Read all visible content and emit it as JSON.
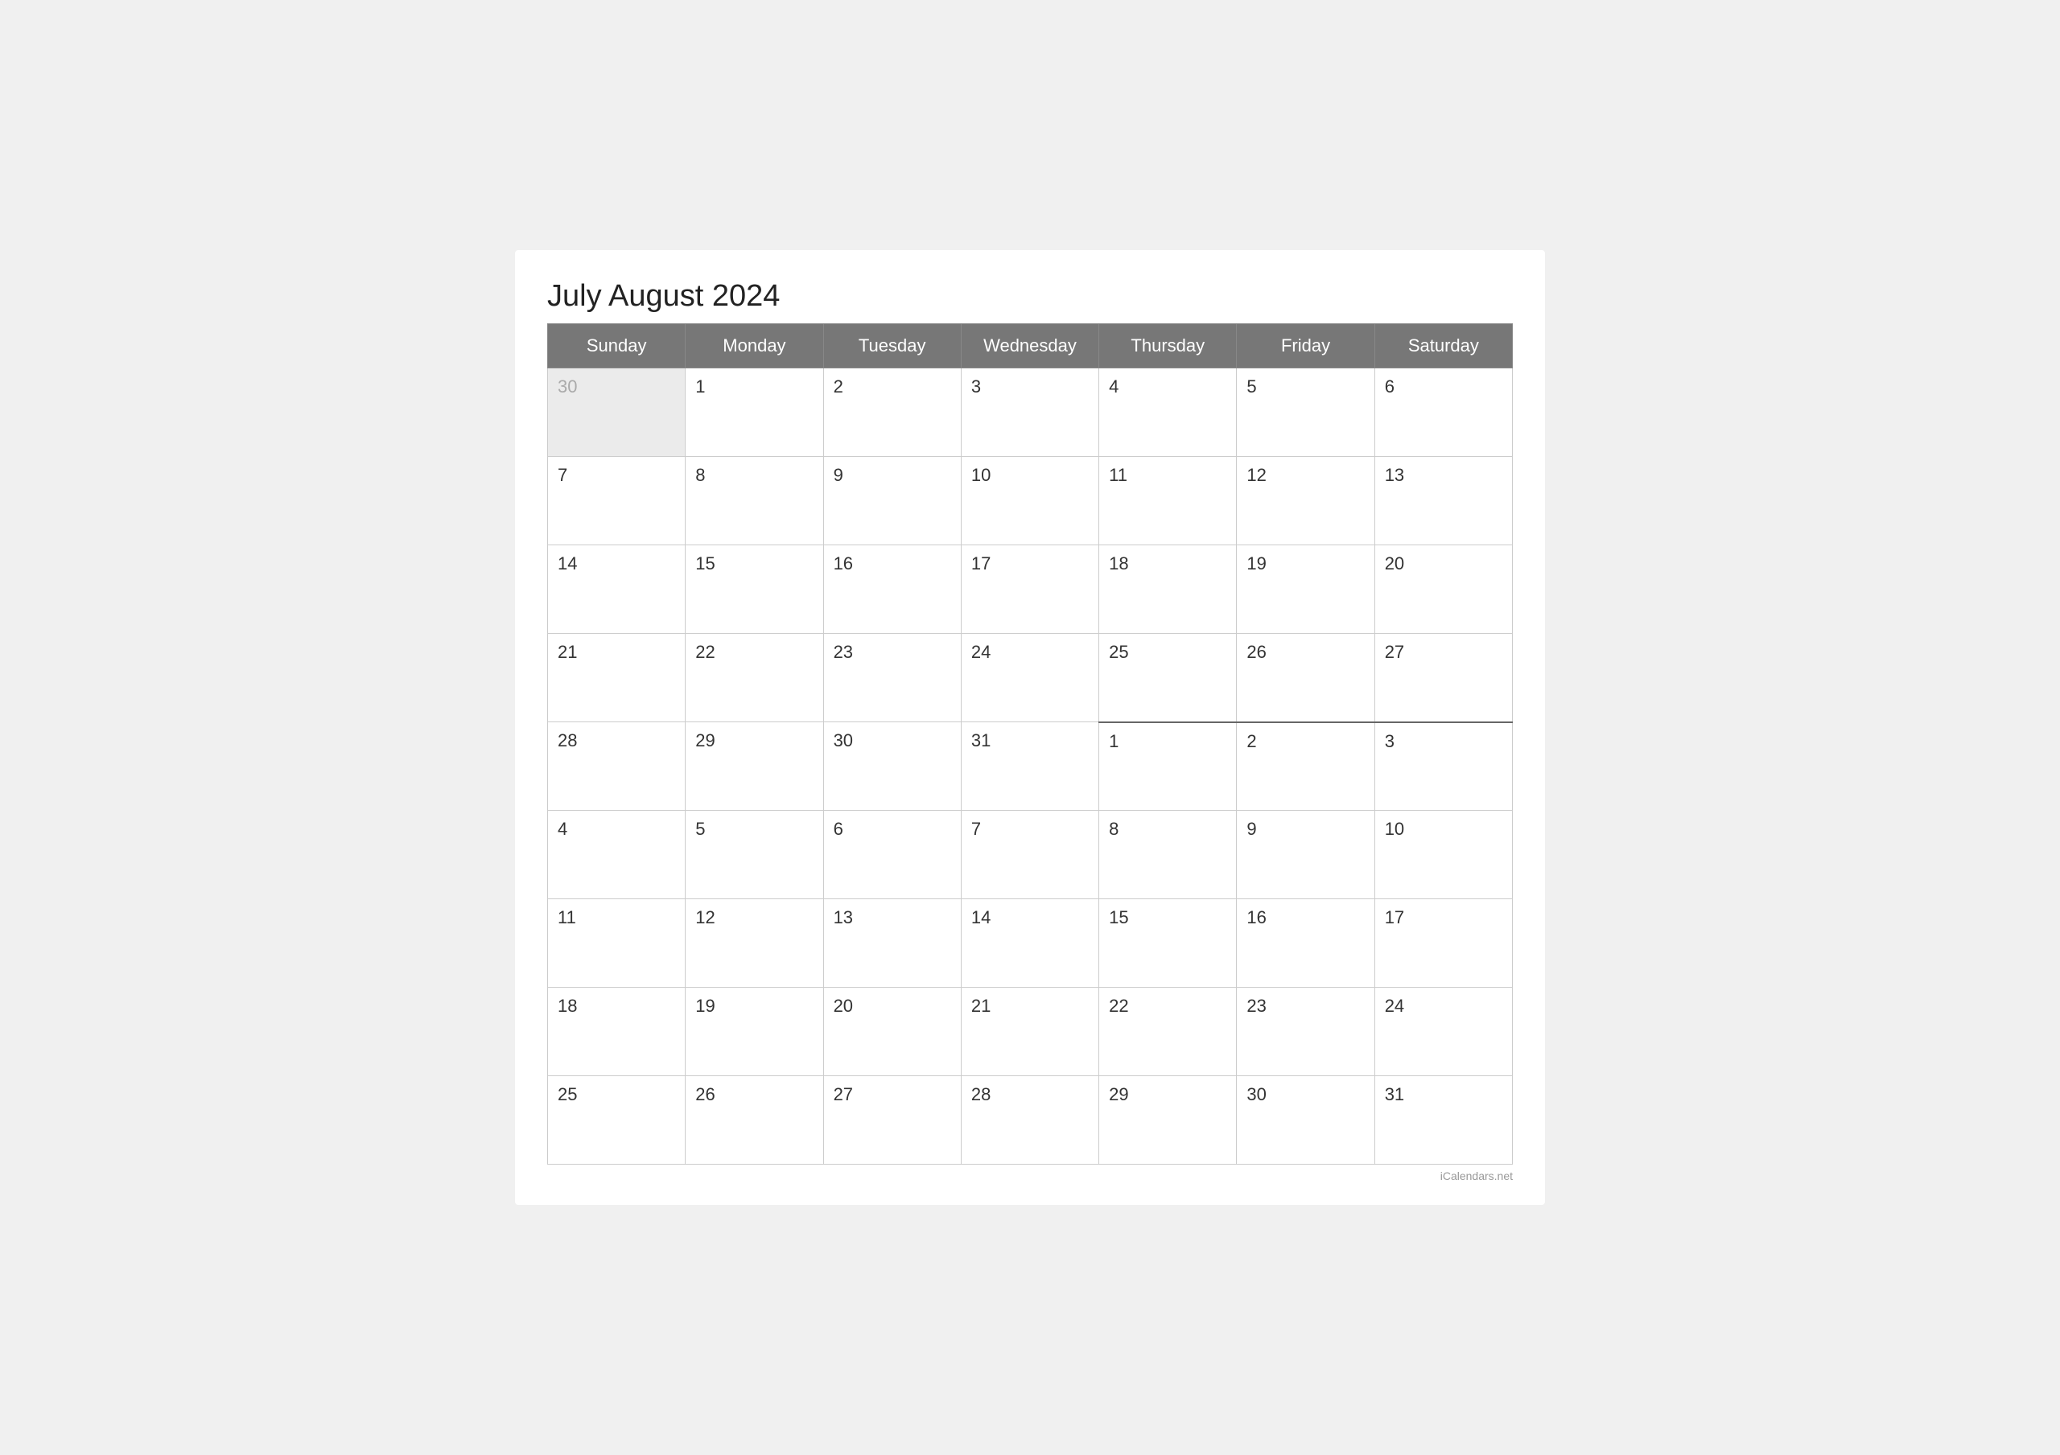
{
  "calendar": {
    "title": "July August 2024",
    "watermark": "iCalendars.net",
    "headers": [
      "Sunday",
      "Monday",
      "Tuesday",
      "Wednesday",
      "Thursday",
      "Friday",
      "Saturday"
    ],
    "weeks": [
      {
        "days": [
          {
            "num": "30",
            "type": "prev-month"
          },
          {
            "num": "1",
            "type": "july"
          },
          {
            "num": "2",
            "type": "july"
          },
          {
            "num": "3",
            "type": "july"
          },
          {
            "num": "4",
            "type": "july"
          },
          {
            "num": "5",
            "type": "july"
          },
          {
            "num": "6",
            "type": "july"
          }
        ]
      },
      {
        "days": [
          {
            "num": "7",
            "type": "july"
          },
          {
            "num": "8",
            "type": "july"
          },
          {
            "num": "9",
            "type": "july"
          },
          {
            "num": "10",
            "type": "july"
          },
          {
            "num": "11",
            "type": "july"
          },
          {
            "num": "12",
            "type": "july"
          },
          {
            "num": "13",
            "type": "july"
          }
        ]
      },
      {
        "days": [
          {
            "num": "14",
            "type": "july"
          },
          {
            "num": "15",
            "type": "july"
          },
          {
            "num": "16",
            "type": "july"
          },
          {
            "num": "17",
            "type": "july"
          },
          {
            "num": "18",
            "type": "july"
          },
          {
            "num": "19",
            "type": "july"
          },
          {
            "num": "20",
            "type": "july"
          }
        ]
      },
      {
        "days": [
          {
            "num": "21",
            "type": "july"
          },
          {
            "num": "22",
            "type": "july"
          },
          {
            "num": "23",
            "type": "july"
          },
          {
            "num": "24",
            "type": "july"
          },
          {
            "num": "25",
            "type": "july"
          },
          {
            "num": "26",
            "type": "july"
          },
          {
            "num": "27",
            "type": "july"
          }
        ]
      },
      {
        "days": [
          {
            "num": "28",
            "type": "july"
          },
          {
            "num": "29",
            "type": "july"
          },
          {
            "num": "30",
            "type": "july"
          },
          {
            "num": "31",
            "type": "july"
          },
          {
            "num": "1",
            "type": "august",
            "divider": true
          },
          {
            "num": "2",
            "type": "august",
            "divider": true
          },
          {
            "num": "3",
            "type": "august",
            "divider": true
          }
        ]
      },
      {
        "days": [
          {
            "num": "4",
            "type": "august"
          },
          {
            "num": "5",
            "type": "august"
          },
          {
            "num": "6",
            "type": "august"
          },
          {
            "num": "7",
            "type": "august"
          },
          {
            "num": "8",
            "type": "august"
          },
          {
            "num": "9",
            "type": "august"
          },
          {
            "num": "10",
            "type": "august"
          }
        ]
      },
      {
        "days": [
          {
            "num": "11",
            "type": "august"
          },
          {
            "num": "12",
            "type": "august"
          },
          {
            "num": "13",
            "type": "august"
          },
          {
            "num": "14",
            "type": "august"
          },
          {
            "num": "15",
            "type": "august"
          },
          {
            "num": "16",
            "type": "august"
          },
          {
            "num": "17",
            "type": "august"
          }
        ]
      },
      {
        "days": [
          {
            "num": "18",
            "type": "august"
          },
          {
            "num": "19",
            "type": "august"
          },
          {
            "num": "20",
            "type": "august"
          },
          {
            "num": "21",
            "type": "august"
          },
          {
            "num": "22",
            "type": "august"
          },
          {
            "num": "23",
            "type": "august"
          },
          {
            "num": "24",
            "type": "august"
          }
        ]
      },
      {
        "days": [
          {
            "num": "25",
            "type": "august"
          },
          {
            "num": "26",
            "type": "august"
          },
          {
            "num": "27",
            "type": "august"
          },
          {
            "num": "28",
            "type": "august"
          },
          {
            "num": "29",
            "type": "august"
          },
          {
            "num": "30",
            "type": "august"
          },
          {
            "num": "31",
            "type": "august"
          }
        ]
      }
    ]
  }
}
